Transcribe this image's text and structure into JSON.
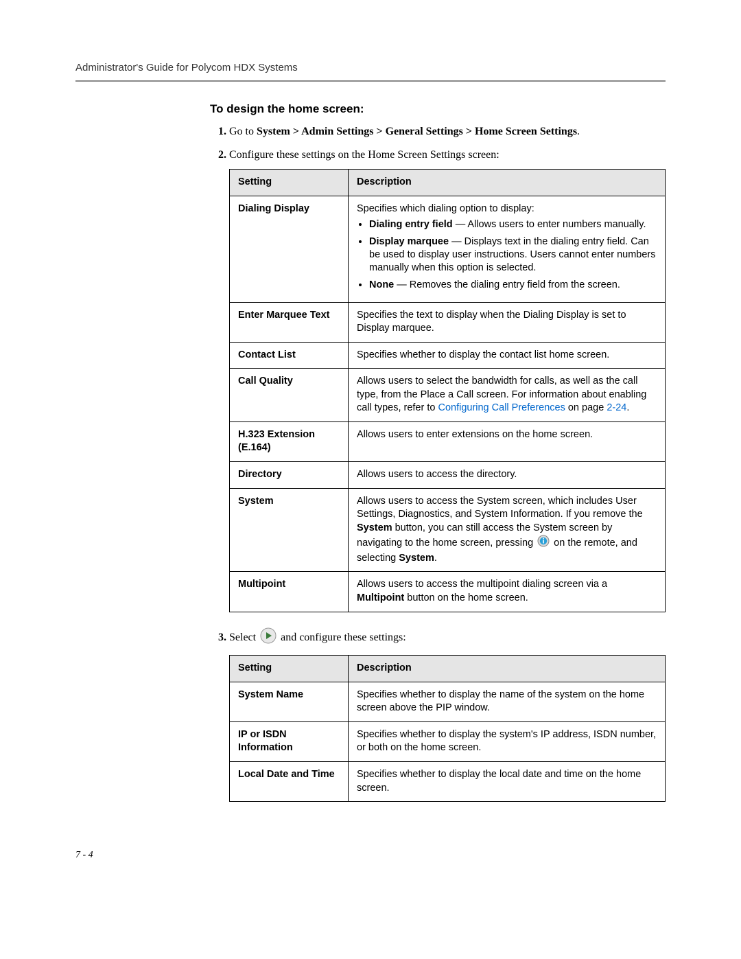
{
  "header": {
    "doc_title": "Administrator's Guide for Polycom HDX Systems"
  },
  "section_heading": "To design the home screen:",
  "steps": {
    "s1_a": "Go to ",
    "s1_b": "System > Admin Settings > General Settings > Home Screen Settings",
    "s1_c": ".",
    "s2": "Configure these settings on the Home Screen Settings screen:",
    "s3_a": "Select ",
    "s3_b": " and configure these settings:"
  },
  "t1": {
    "h_setting": "Setting",
    "h_desc": "Description",
    "rows": [
      {
        "name": "Dialing Display",
        "intro": "Specifies which dialing option to display:",
        "bullets": [
          {
            "b": "Dialing entry field",
            "t": " — Allows users to enter numbers manually."
          },
          {
            "b": "Display marquee",
            "t": " — Displays text in the dialing entry field. Can be used to display user instructions. Users cannot enter numbers manually when this option is selected."
          },
          {
            "b": "None",
            "t": " — Removes the dialing entry field from the screen."
          }
        ]
      },
      {
        "name": "Enter Marquee Text",
        "desc": "Specifies the text to display when the Dialing Display is set to Display marquee."
      },
      {
        "name": "Contact List",
        "desc": "Specifies whether to display the contact list home screen."
      },
      {
        "name": "Call Quality",
        "desc_a": "Allows users to select the bandwidth for calls, as well as the call type, from the Place a Call screen. For information about enabling call types, refer to ",
        "link": "Configuring Call Preferences",
        "desc_b": " on page ",
        "link2": "2-24",
        "desc_c": "."
      },
      {
        "name": "H.323 Extension (E.164)",
        "desc": "Allows users to enter extensions on the home screen."
      },
      {
        "name": "Directory",
        "desc": "Allows users to access the directory."
      },
      {
        "name": "System",
        "desc_a": "Allows users to access the System screen, which includes User Settings, Diagnostics, and System Information. If you remove the ",
        "b1": "System",
        "desc_b": " button, you can still access the System screen by navigating to the home screen, pressing ",
        "desc_c": " on the remote, and selecting ",
        "b2": "System",
        "desc_d": "."
      },
      {
        "name": "Multipoint",
        "desc_a": "Allows users to access the multipoint dialing screen via a ",
        "b1": "Multipoint",
        "desc_b": " button on the home screen."
      }
    ]
  },
  "t2": {
    "h_setting": "Setting",
    "h_desc": "Description",
    "rows": [
      {
        "name": "System Name",
        "desc": "Specifies whether to display the name of the system on the home screen above the PIP window."
      },
      {
        "name": "IP or ISDN Information",
        "desc": "Specifies whether to display the system's IP address, ISDN number, or both on the home screen."
      },
      {
        "name": "Local Date and Time",
        "desc": "Specifies whether to display the local date and time on the home screen."
      }
    ]
  },
  "page_number": "7 - 4"
}
